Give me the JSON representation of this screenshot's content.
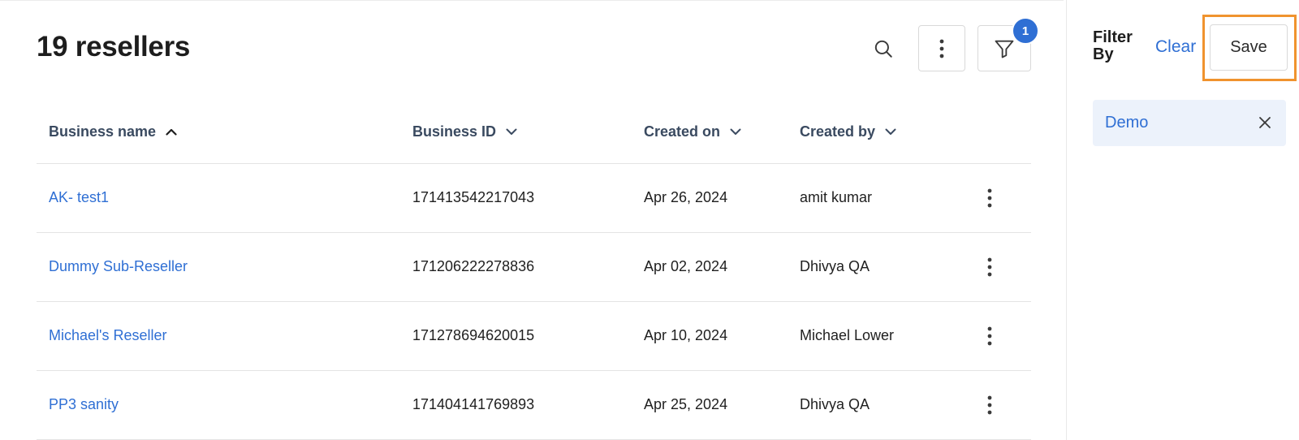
{
  "header": {
    "title": "19 resellers",
    "filter_count": "1",
    "icons": {
      "search": "search-icon",
      "more": "more-vertical-icon",
      "filter": "filter-icon"
    }
  },
  "table": {
    "columns": [
      {
        "label": "Business name",
        "sort": "ascending"
      },
      {
        "label": "Business ID",
        "sort": "none"
      },
      {
        "label": "Created on",
        "sort": "none"
      },
      {
        "label": "Created by",
        "sort": "none"
      }
    ],
    "rows": [
      {
        "name": "AK- test1",
        "id": "171413542217043",
        "created_on": "Apr 26, 2024",
        "created_by": "amit kumar"
      },
      {
        "name": "Dummy Sub-Reseller",
        "id": "171206222278836",
        "created_on": "Apr 02, 2024",
        "created_by": "Dhivya QA"
      },
      {
        "name": "Michael's Reseller",
        "id": "171278694620015",
        "created_on": "Apr 10, 2024",
        "created_by": "Michael Lower"
      },
      {
        "name": "PP3 sanity",
        "id": "171404141769893",
        "created_on": "Apr 25, 2024",
        "created_by": "Dhivya QA"
      }
    ]
  },
  "filter_panel": {
    "title": "Filter By",
    "clear_label": "Clear",
    "save_label": "Save",
    "chips": [
      {
        "label": "Demo"
      }
    ]
  },
  "colors": {
    "accent": "#2f6fd4",
    "highlight": "#f0932e",
    "chip_bg": "#ecf2fb"
  }
}
